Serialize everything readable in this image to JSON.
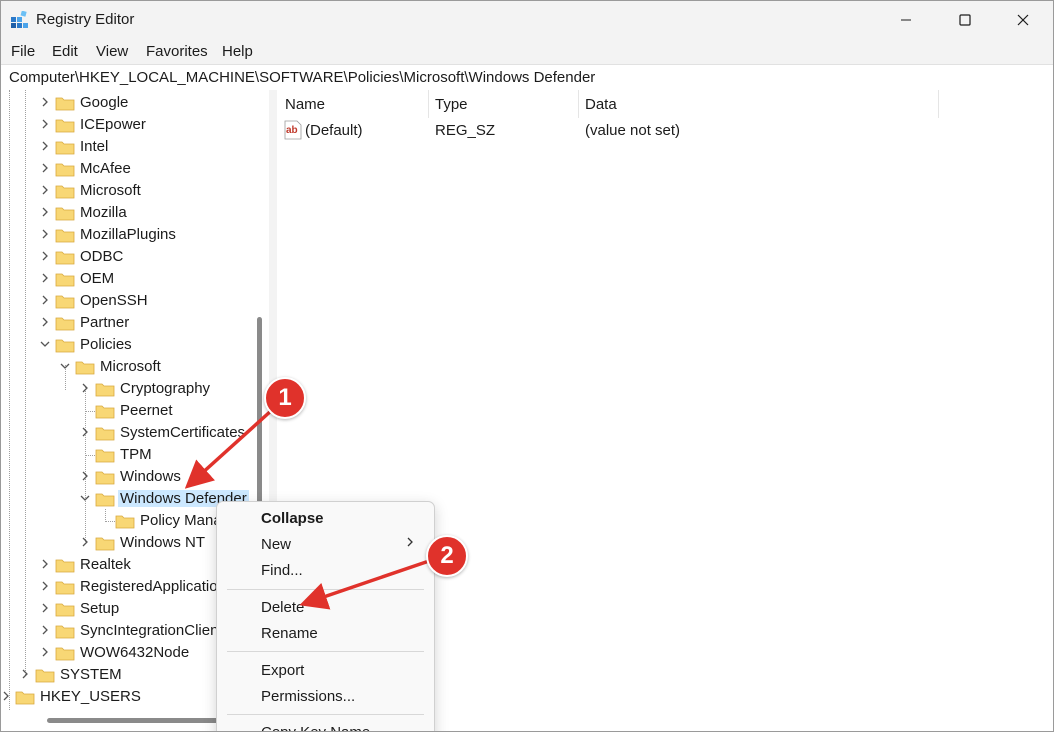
{
  "window": {
    "title": "Registry Editor",
    "icons": {
      "app": "registry-icon",
      "minimize": "minimize-icon",
      "maximize": "maximize-icon",
      "close": "close-icon"
    }
  },
  "menu": [
    "File",
    "Edit",
    "View",
    "Favorites",
    "Help"
  ],
  "address": "Computer\\HKEY_LOCAL_MACHINE\\SOFTWARE\\Policies\\Microsoft\\Windows Defender",
  "tree": {
    "google": "Google",
    "icepower": "ICEpower",
    "intel": "Intel",
    "mcafee": "McAfee",
    "microsoft": "Microsoft",
    "mozilla": "Mozilla",
    "mozillaplugins": "MozillaPlugins",
    "odbc": "ODBC",
    "oem": "OEM",
    "openssh": "OpenSSH",
    "partner": "Partner",
    "policies": "Policies",
    "policies_microsoft": "Microsoft",
    "cryptography": "Cryptography",
    "peernet": "Peernet",
    "systemcertificates": "SystemCertificates",
    "tpm": "TPM",
    "windows": "Windows",
    "windows_defender": "Windows Defender",
    "policy_manager": "Policy Mana",
    "windows_nt": "Windows NT",
    "realtek": "Realtek",
    "registeredapplications": "RegisteredApplicatio",
    "setup": "Setup",
    "syncintegration": "SyncIntegrationClien",
    "wow6432node": "WOW6432Node",
    "system": "SYSTEM",
    "hkey_users": "HKEY_USERS"
  },
  "values": {
    "headers": {
      "name": "Name",
      "type": "Type",
      "data": "Data"
    },
    "rows": [
      {
        "name": "(Default)",
        "type": "REG_SZ",
        "data": "(value not set)"
      }
    ]
  },
  "context_menu": {
    "collapse": "Collapse",
    "new": "New",
    "find": "Find...",
    "delete": "Delete",
    "rename": "Rename",
    "export": "Export",
    "permissions": "Permissions...",
    "copy_key_name": "Copy Key Name"
  },
  "annotations": {
    "step1": "1",
    "step2": "2",
    "color": "#e0322b"
  },
  "colors": {
    "folder": "#f8d775",
    "selection": "#cce8ff",
    "accent": "#0067c0"
  }
}
